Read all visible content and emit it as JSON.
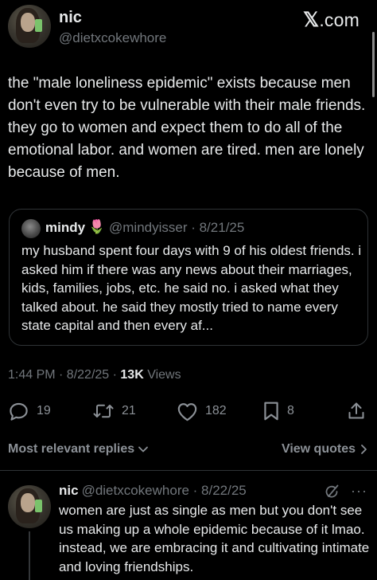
{
  "header": {
    "display_name": "nic",
    "handle": "@dietxcokewhore",
    "brand_x": "𝕏",
    "brand_suffix": ".com"
  },
  "tweet": {
    "text": "the \"male loneliness epidemic\" exists because men don't even try to be vulnerable with their male friends. they go to women and expect them to do all of the emotional labor. and women are tired. men are lonely because of men.",
    "time": "1:44 PM · 8/22/25 · ",
    "views_count": "13K",
    "views_label": " Views"
  },
  "quote": {
    "name": "mindy",
    "emoji": "🌷",
    "meta": "@mindyisser · 8/21/25",
    "text": "my husband spent four days with  9 of his oldest friends. i asked him if there was any news about their marriages, kids, families, jobs, etc. he said no. i asked what they talked about. he said they mostly tried to name every state capital and then every af..."
  },
  "actions": {
    "replies": "19",
    "reposts": "21",
    "likes": "182",
    "bookmarks": "8"
  },
  "replies_header": {
    "sort_label": "Most relevant replies",
    "view_quotes": "View quotes"
  },
  "reply": {
    "name": "nic",
    "meta": "@dietxcokewhore · 8/22/25",
    "more": "···",
    "text": "women are just as single as men but you don't see us making up a whole epidemic because of it lmao. instead, we are embracing it and cultivating intimate and loving friendships."
  },
  "colors": {
    "background": "#000000",
    "text": "#e7e9ea",
    "muted": "#71767b",
    "border": "#2f3336",
    "tulip": "#e0245e"
  },
  "icons": [
    "reply-icon",
    "repost-icon",
    "like-icon",
    "bookmark-icon",
    "share-icon",
    "chevron-down-icon",
    "chevron-right-icon",
    "grok-icon",
    "more-icon"
  ]
}
